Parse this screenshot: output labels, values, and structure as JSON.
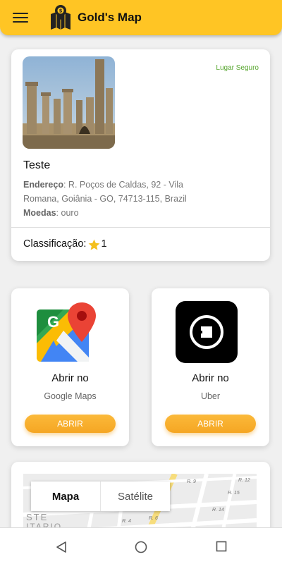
{
  "app": {
    "title": "Gold's Map"
  },
  "place": {
    "badge": "Lugar Seguro",
    "name": "Teste",
    "address_label": "Endereço",
    "address": "R. Poços de Caldas, 92 - Vila Romana, Goiânia - GO, 74713-115, Brazil",
    "coins_label": "Moedas",
    "coins": "ouro",
    "rating_label": "Classificação:",
    "rating": "1"
  },
  "open_cards": [
    {
      "title": "Abrir no",
      "subtitle": "Google Maps",
      "button": "ABRIR",
      "icon": "google-maps-icon"
    },
    {
      "title": "Abrir no",
      "subtitle": "Uber",
      "button": "ABRIR",
      "icon": "uber-icon"
    }
  ],
  "map": {
    "tab_map": "Mapa",
    "tab_satellite": "Satélite",
    "street_labels": [
      "R. 9",
      "R. 12",
      "R. 15",
      "R. 14",
      "R. 4",
      "R. 6",
      "STE",
      "ITARIO"
    ]
  },
  "colors": {
    "accent": "#ffc524",
    "button": "#f5a623",
    "safe": "#5aa832"
  }
}
